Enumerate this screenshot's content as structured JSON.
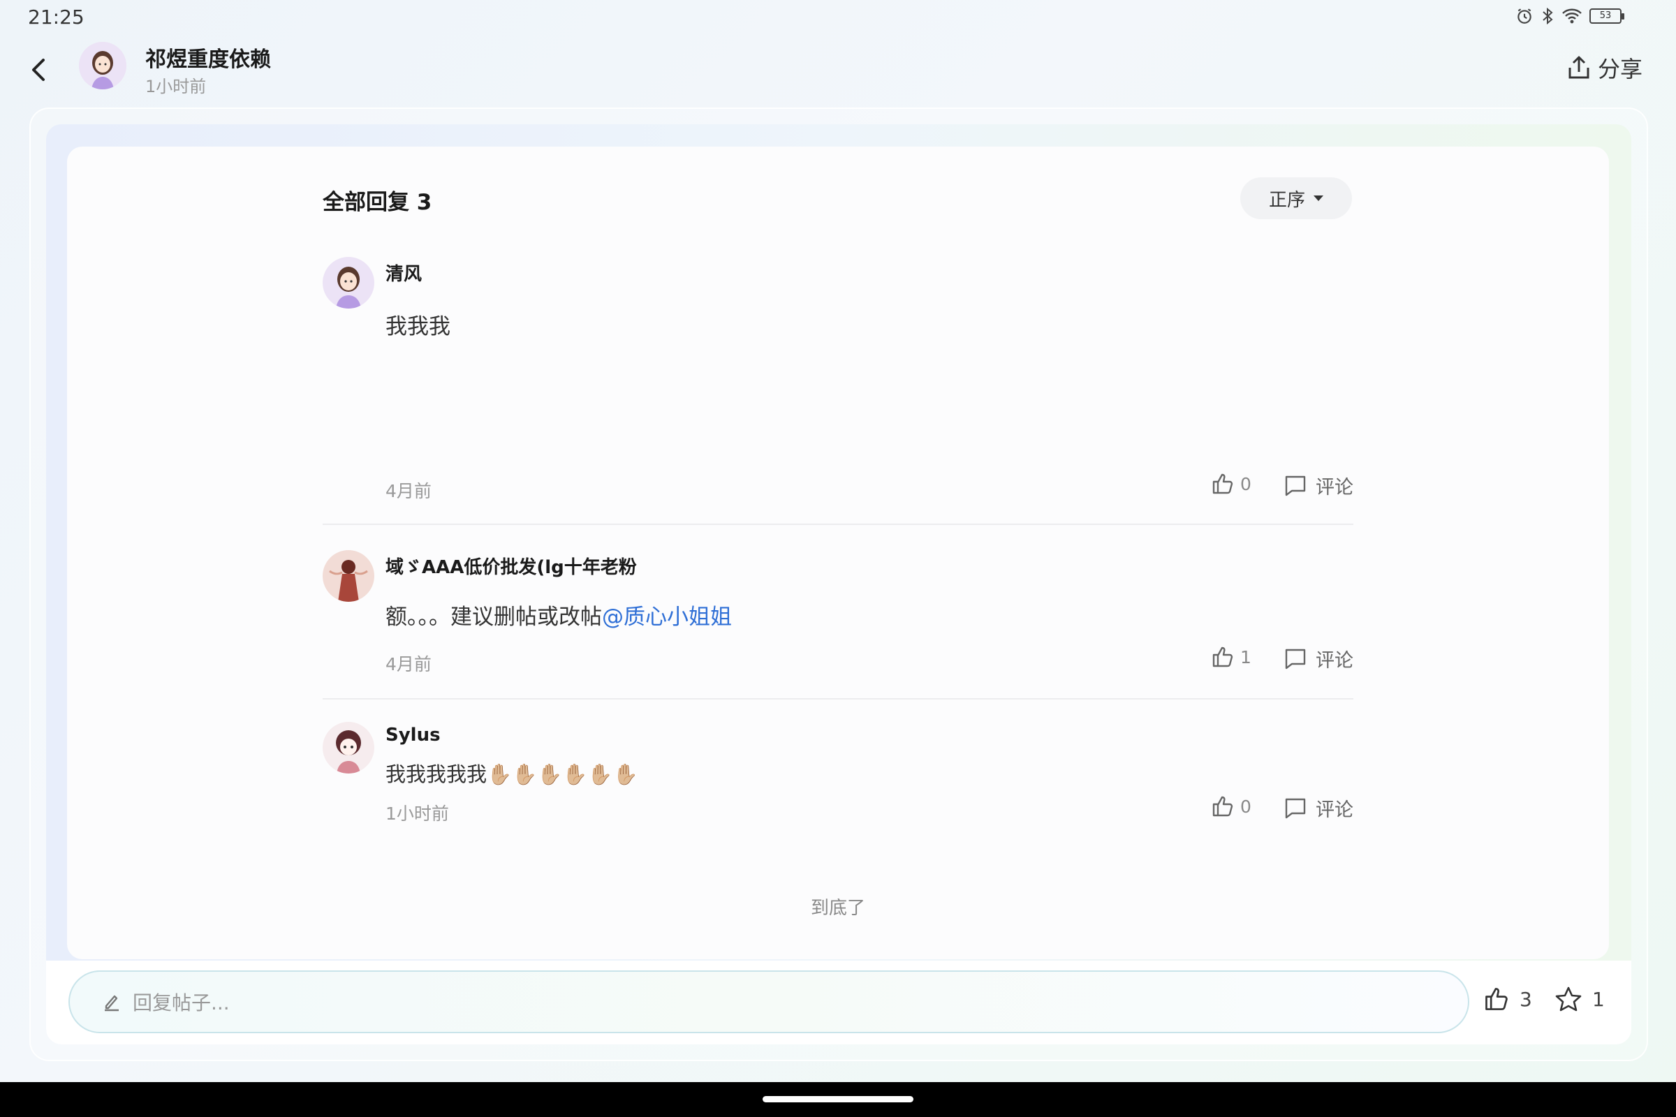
{
  "status_bar": {
    "time": "21:25",
    "battery": "53"
  },
  "header": {
    "author": "祁煜重度依赖",
    "time": "1小时前",
    "share_label": "分享"
  },
  "replies_section": {
    "title": "全部回复 3",
    "sort_label": "正序"
  },
  "replies": [
    {
      "name": "清风",
      "text": "我我我",
      "time": "4月前",
      "likes": "0",
      "comment_label": "评论"
    },
    {
      "name": "域ゞAAA低价批发(lg十年老粉",
      "text": "额。。。建议删帖或改帖",
      "mention": "@质心小姐姐",
      "time": "4月前",
      "likes": "1",
      "comment_label": "评论"
    },
    {
      "name": "Sylus",
      "text": "我我我我我✋🏼✋🏼✋🏼✋🏼✋🏼✋🏼",
      "time": "1小时前",
      "likes": "0",
      "comment_label": "评论"
    }
  ],
  "end_text": "到底了",
  "bottom_bar": {
    "placeholder": "回复帖子...",
    "likes": "3",
    "favorites": "1"
  },
  "colors": {
    "mention": "#2f6fd6",
    "accent_border": "#c9e4ea"
  },
  "icons": [
    "back-arrow-icon",
    "share-icon",
    "thumb-up-icon",
    "comment-icon",
    "pencil-icon",
    "star-icon",
    "alarm-icon",
    "bluetooth-icon",
    "wifi-icon",
    "battery-icon"
  ]
}
